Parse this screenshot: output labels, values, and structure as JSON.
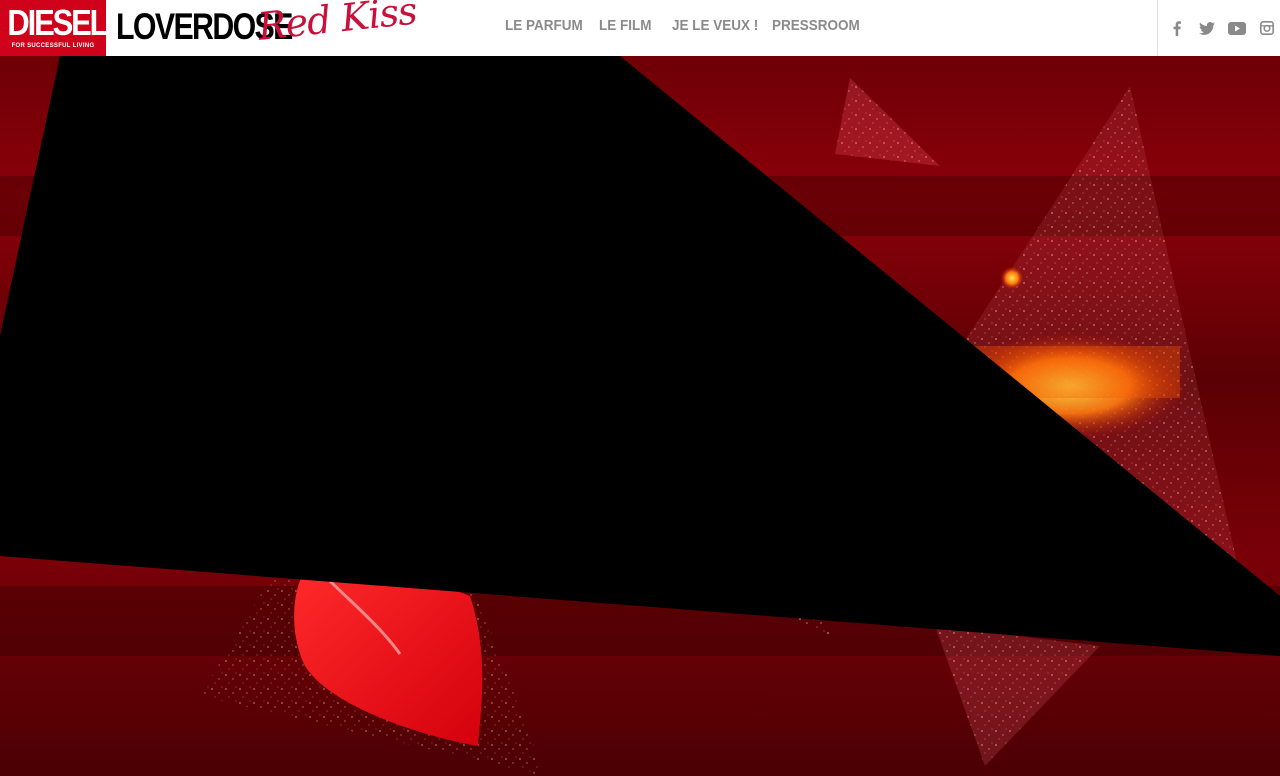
{
  "brand": {
    "diesel": "DIESEL",
    "diesel_tagline": "FOR SUCCESSFUL LIVING",
    "product": "LOVERDOSE",
    "edition": "Red Kiss"
  },
  "nav": {
    "items": [
      {
        "label": "LE PARFUM"
      },
      {
        "label": "LE FILM"
      },
      {
        "label": "JE LE VEUX !"
      },
      {
        "label": "PRESSROOM"
      }
    ]
  },
  "social": {
    "icons": [
      "facebook-icon",
      "twitter-icon",
      "youtube-icon",
      "instagram-icon"
    ]
  },
  "colors": {
    "brand_red": "#d0021b",
    "script_pink": "#c8103a",
    "nav_grey": "#8a8a8a"
  }
}
